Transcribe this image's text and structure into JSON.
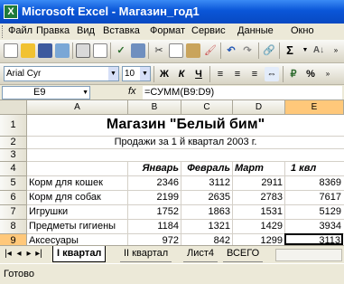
{
  "window": {
    "title": "Microsoft Excel - Магазин_год1",
    "app_icon": "X"
  },
  "menu": [
    "Файл",
    "Правка",
    "Вид",
    "Вставка",
    "Формат",
    "Сервис",
    "Данные",
    "Окно"
  ],
  "toolbar": {
    "font_name": "Arial Cyr",
    "font_size": "10",
    "bold": "Ж",
    "italic": "К",
    "underline": "Ч",
    "sum_icon": "Σ"
  },
  "formula_bar": {
    "name_box": "E9",
    "fx_label": "fx",
    "formula": "=СУММ(B9:D9)"
  },
  "columns": [
    "A",
    "B",
    "C",
    "D",
    "E"
  ],
  "rows": [
    "1",
    "2",
    "3",
    "4",
    "5",
    "6",
    "7",
    "8",
    "9"
  ],
  "sheet": {
    "title": "Магазин \"Белый бим\"",
    "subtitle": "Продажи за 1 й квартал 2003 г.",
    "headers": [
      "Январь",
      "Февраль",
      "Март",
      "1 квл"
    ],
    "data": [
      {
        "name": "Корм для кошек",
        "values": [
          "2346",
          "3112",
          "2911",
          "8369"
        ]
      },
      {
        "name": "Корм для собак",
        "values": [
          "2199",
          "2635",
          "2783",
          "7617"
        ]
      },
      {
        "name": "Игрушки",
        "values": [
          "1752",
          "1863",
          "1531",
          "5129"
        ]
      },
      {
        "name": "Предметы гигиены",
        "values": [
          "1184",
          "1321",
          "1429",
          "3934"
        ]
      },
      {
        "name": "Аксесуары",
        "values": [
          "972",
          "842",
          "1299",
          "3113"
        ]
      }
    ]
  },
  "tabs": [
    "I квартал",
    "II квартал",
    "Лист4",
    "ВСЕГО"
  ],
  "status": "Готово"
}
